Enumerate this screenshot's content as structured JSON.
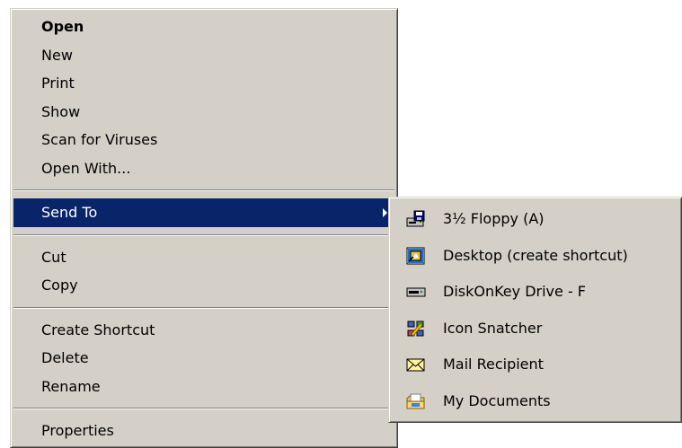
{
  "context_menu": {
    "items": [
      {
        "label": "Open"
      },
      {
        "label": "New"
      },
      {
        "label": "Print"
      },
      {
        "label": "Show"
      },
      {
        "label": "Scan for Viruses"
      },
      {
        "label": "Open With..."
      },
      {
        "label": "Send To"
      },
      {
        "label": "Cut"
      },
      {
        "label": "Copy"
      },
      {
        "label": "Create Shortcut"
      },
      {
        "label": "Delete"
      },
      {
        "label": "Rename"
      },
      {
        "label": "Properties"
      }
    ]
  },
  "send_to_submenu": {
    "items": [
      {
        "label": "3½ Floppy (A)",
        "icon": "floppy-drive-icon"
      },
      {
        "label": "Desktop (create shortcut)",
        "icon": "desktop-icon"
      },
      {
        "label": "DiskOnKey Drive - F",
        "icon": "removable-drive-icon"
      },
      {
        "label": "Icon Snatcher",
        "icon": "icon-snatcher-icon"
      },
      {
        "label": "Mail Recipient",
        "icon": "mail-envelope-icon"
      },
      {
        "label": "My Documents",
        "icon": "documents-folder-icon"
      }
    ]
  },
  "colors": {
    "menu_background": "#d4d0c8",
    "selection_background": "#0a246a",
    "selection_text": "#ffffff"
  }
}
